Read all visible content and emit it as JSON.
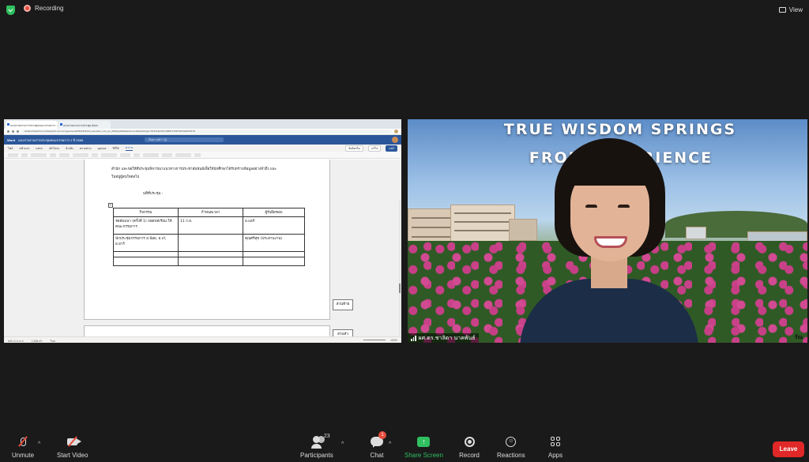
{
  "topbar": {
    "recording_label": "Recording",
    "view_label": "View"
  },
  "shared_screen": {
    "browser_tabs": [
      "แบบรายงานการประชุมคณะกรรมการ...",
      "แบบรายงานการประชุม.docx"
    ],
    "url": "studentmfuacth-my.sharepoint.com/:w:/g/personal/6531501234_lamduan_mfu_ac_th/EQwpW9k&action=edit&wdOrigin=OFFICECOM-WEB.START.EDGEWORTH",
    "word": {
      "app_name": "Word",
      "doc_title": "แบบรายงานการประชุมคณะกรรมการ 1 ปี 2566",
      "search_placeholder": "ค้นหา (Alt + Q)",
      "ribbon_tabs": [
        "ไฟล์",
        "หน้าแรก",
        "แทรก",
        "เค้าโครง",
        "อ้างอิง",
        "ตรวจทาน",
        "มุมมอง",
        "วิธีใช้",
        "ตาราง"
      ],
      "ribbon_buttons": [
        "ข้อคิดเห็น",
        "แก้ไข",
        "แชร์"
      ]
    },
    "document": {
      "line1": "สำนัก และขอให้ที่ประชุมพิจารณาแนวทางการประชาสัมพันธ์เพื่อให้นักศึกษาได้รับทราบข้อมูลอย่างทั่วถึง และ",
      "line2": "ในหมู่ผู้สนใจต่อไป",
      "heading": "มติที่ประชุม :",
      "table_headers": [
        "กิจกรรม",
        "กำหนดเวลา",
        "ผู้รับผิดชอบ"
      ],
      "rows": [
        [
          "จัดสัมมนา (ครั้งที่ 1) ถอดบทเรียน ให้คณะกรรมการ",
          "11 ก.ย.",
          "อ.แอร์"
        ],
        [
          "นักประชุมกรรมการ อ.น้อย, อ.เก๋, อ.อาร์",
          "",
          "คุณศรีสุข (ประสานงาน)"
        ],
        [
          "",
          "",
          ""
        ],
        [
          "",
          "",
          ""
        ]
      ],
      "side_buttons": [
        "ส่วนท้าย",
        "ส่วนหัว"
      ]
    },
    "statusbar": {
      "page": "หน้า 4 จาก 4",
      "words": "1,536 คำ",
      "language": "ไทย",
      "zoom": "100%"
    }
  },
  "video": {
    "banner_line1": "TRUE WISDOM SPRINGS",
    "banner_line2": "FROM LIV        ERIENCE",
    "banner_line3": "ประส             ญา",
    "participant_name": "ผศ.ดร.ชาลิดา นาคพันธ์",
    "name_overflow": "รัณ"
  },
  "toolbar": {
    "unmute": "Unmute",
    "start_video": "Start Video",
    "participants": "Participants",
    "participant_count": "23",
    "chat": "Chat",
    "chat_badge": "1",
    "share_screen": "Share Screen",
    "record": "Record",
    "reactions": "Reactions",
    "apps": "Apps",
    "leave": "Leave"
  },
  "colors": {
    "leave": "#e02828",
    "share": "#2fbf5f",
    "word_blue": "#2b579a",
    "recording": "#e64a3b"
  }
}
